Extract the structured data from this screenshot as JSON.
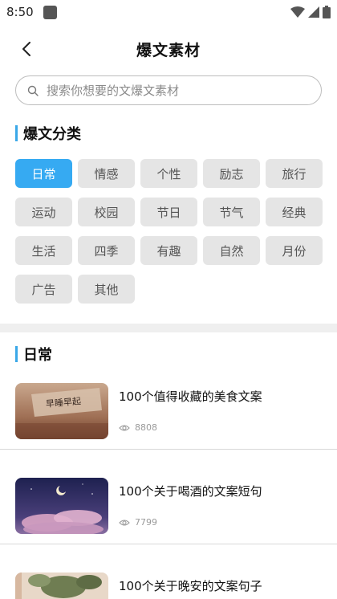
{
  "status_bar": {
    "time": "8:50"
  },
  "header": {
    "title": "爆文素材",
    "back_icon": "chevron-left-icon"
  },
  "search": {
    "placeholder": "搜索你想要的文爆文素材",
    "icon": "search-icon"
  },
  "categories_section": {
    "title": "爆文分类",
    "accent_color": "#3aa8e8",
    "active_color": "#36aaf2",
    "items": [
      {
        "label": "日常",
        "active": true
      },
      {
        "label": "情感",
        "active": false
      },
      {
        "label": "个性",
        "active": false
      },
      {
        "label": "励志",
        "active": false
      },
      {
        "label": "旅行",
        "active": false
      },
      {
        "label": "运动",
        "active": false
      },
      {
        "label": "校园",
        "active": false
      },
      {
        "label": "节日",
        "active": false
      },
      {
        "label": "节气",
        "active": false
      },
      {
        "label": "经典",
        "active": false
      },
      {
        "label": "生活",
        "active": false
      },
      {
        "label": "四季",
        "active": false
      },
      {
        "label": "有趣",
        "active": false
      },
      {
        "label": "自然",
        "active": false
      },
      {
        "label": "月份",
        "active": false
      },
      {
        "label": "广告",
        "active": false
      },
      {
        "label": "其他",
        "active": false
      }
    ]
  },
  "list_section": {
    "title": "日常",
    "articles": [
      {
        "title": "100个值得收藏的美食文案",
        "views": "8808",
        "view_icon": "eye-icon"
      },
      {
        "title": "100个关于喝酒的文案短句",
        "views": "7799",
        "view_icon": "eye-icon"
      },
      {
        "title": "100个关于晚安的文案句子",
        "views": "",
        "view_icon": "eye-icon"
      }
    ]
  }
}
